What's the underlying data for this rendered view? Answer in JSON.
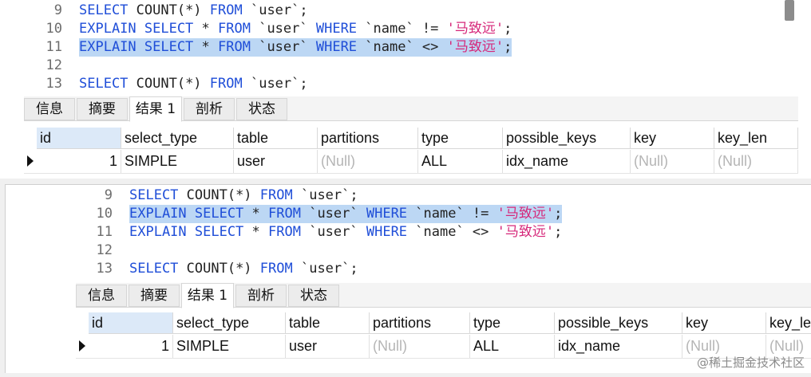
{
  "top": {
    "lines": [
      {
        "n": "9",
        "tokens": [
          {
            "t": "SELECT",
            "c": "kw"
          },
          {
            "t": " COUNT(*) ",
            "c": "id"
          },
          {
            "t": "FROM",
            "c": "kw"
          },
          {
            "t": " `user`;",
            "c": "id"
          }
        ]
      },
      {
        "n": "10",
        "tokens": [
          {
            "t": "EXPLAIN SELECT",
            "c": "kw"
          },
          {
            "t": " * ",
            "c": "id"
          },
          {
            "t": "FROM",
            "c": "kw"
          },
          {
            "t": " `user` ",
            "c": "id"
          },
          {
            "t": "WHERE",
            "c": "kw"
          },
          {
            "t": " `name` != ",
            "c": "id"
          },
          {
            "t": "'马致远'",
            "c": "str"
          },
          {
            "t": ";",
            "c": "id"
          }
        ]
      },
      {
        "n": "11",
        "hl": true,
        "tokens": [
          {
            "t": "EXPLAIN SELECT",
            "c": "kw"
          },
          {
            "t": " * ",
            "c": "id"
          },
          {
            "t": "FROM",
            "c": "kw"
          },
          {
            "t": " `user` ",
            "c": "id"
          },
          {
            "t": "WHERE",
            "c": "kw"
          },
          {
            "t": " `name` <> ",
            "c": "id"
          },
          {
            "t": "'马致远'",
            "c": "str"
          },
          {
            "t": ";",
            "c": "id"
          }
        ]
      },
      {
        "n": "12",
        "tokens": []
      },
      {
        "n": "13",
        "tokens": [
          {
            "t": "SELECT",
            "c": "kw"
          },
          {
            "t": " COUNT(*) ",
            "c": "id"
          },
          {
            "t": "FROM",
            "c": "kw"
          },
          {
            "t": " `user`;",
            "c": "id"
          }
        ]
      }
    ]
  },
  "bottom": {
    "lines": [
      {
        "n": "9",
        "tokens": [
          {
            "t": "SELECT",
            "c": "kw"
          },
          {
            "t": " COUNT(*) ",
            "c": "id"
          },
          {
            "t": "FROM",
            "c": "kw"
          },
          {
            "t": " `user`;",
            "c": "id"
          }
        ]
      },
      {
        "n": "10",
        "hl": true,
        "tokens": [
          {
            "t": "EXPLAIN SELECT",
            "c": "kw"
          },
          {
            "t": " * ",
            "c": "id"
          },
          {
            "t": "FROM",
            "c": "kw"
          },
          {
            "t": " `user` ",
            "c": "id"
          },
          {
            "t": "WHERE",
            "c": "kw"
          },
          {
            "t": " `name` != ",
            "c": "id"
          },
          {
            "t": "'马致远'",
            "c": "str"
          },
          {
            "t": ";",
            "c": "id"
          }
        ]
      },
      {
        "n": "11",
        "tokens": [
          {
            "t": "EXPLAIN SELECT",
            "c": "kw"
          },
          {
            "t": " * ",
            "c": "id"
          },
          {
            "t": "FROM",
            "c": "kw"
          },
          {
            "t": " `user` ",
            "c": "id"
          },
          {
            "t": "WHERE",
            "c": "kw"
          },
          {
            "t": " `name` <> ",
            "c": "id"
          },
          {
            "t": "'马致远'",
            "c": "str"
          },
          {
            "t": ";",
            "c": "id"
          }
        ]
      },
      {
        "n": "12",
        "tokens": []
      },
      {
        "n": "13",
        "tokens": [
          {
            "t": "SELECT",
            "c": "kw"
          },
          {
            "t": " COUNT(*) ",
            "c": "id"
          },
          {
            "t": "FROM",
            "c": "kw"
          },
          {
            "t": " `user`;",
            "c": "id"
          }
        ]
      }
    ]
  },
  "tabs": {
    "info": "信息",
    "summary": "摘要",
    "result1": "结果 1",
    "profile": "剖析",
    "status": "状态"
  },
  "columns": [
    "id",
    "select_type",
    "table",
    "partitions",
    "type",
    "possible_keys",
    "key",
    "key_len"
  ],
  "row": [
    "1",
    "SIMPLE",
    "user",
    "(Null)",
    "ALL",
    "idx_name",
    "(Null)",
    "(Null)"
  ],
  "watermark": "@稀土掘金技术社区",
  "colors": {
    "keyword": "#1f4ed8",
    "string": "#d6287a",
    "highlight": "#bcd7f4",
    "null": "#b5b5b5"
  }
}
